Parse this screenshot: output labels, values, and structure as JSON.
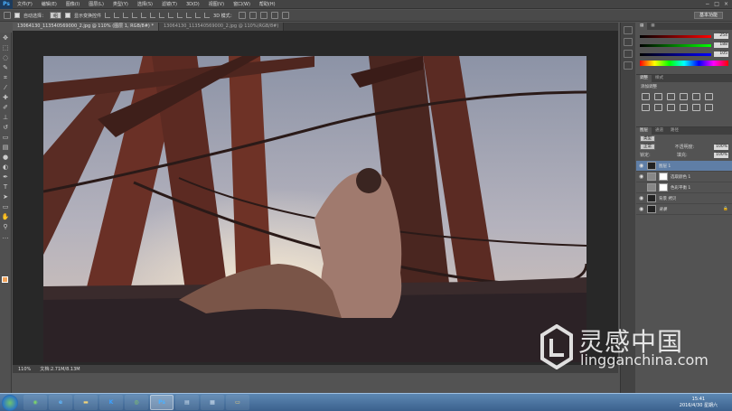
{
  "menubar": {
    "logo": "Ps",
    "items": [
      "文件(F)",
      "编辑(E)",
      "图像(I)",
      "图层(L)",
      "类型(Y)",
      "选择(S)",
      "滤镜(T)",
      "3D(D)",
      "视图(V)",
      "窗口(W)",
      "帮助(H)"
    ]
  },
  "options": {
    "auto_select_label": "自动选择：",
    "auto_select_value": "组",
    "show_transform_label": "显示变换控件",
    "mode_3d_label": "3D 模式：",
    "workspace_label": "基本功能"
  },
  "tabs": [
    {
      "label": "13064130_113540569000_2.jpg @ 110% (图层 1, RGB/8#) *",
      "active": true
    },
    {
      "label": "13064130_113540569000_2.jpg @ 110%(RGB/8#)",
      "active": false
    }
  ],
  "status": {
    "zoom": "110%",
    "doc": "文档:2.71M/8.13M"
  },
  "color_panel": {
    "values": [
      "254",
      "188",
      "105"
    ]
  },
  "adjustments": {
    "tabs": [
      "调整",
      "样式"
    ],
    "title": "添加调整"
  },
  "layers_panel": {
    "tabs": [
      "图层",
      "通道",
      "路径"
    ],
    "kind_label": "类型",
    "blend_mode": "正常",
    "opacity_label": "不透明度:",
    "opacity_value": "100%",
    "lock_label": "锁定:",
    "fill_label": "填充:",
    "fill_value": "100%",
    "layers": [
      {
        "name": "图层 1",
        "selected": true,
        "visible": true,
        "mask": false
      },
      {
        "name": "选取颜色 1",
        "selected": false,
        "visible": true,
        "mask": true
      },
      {
        "name": "色彩平衡 1",
        "selected": false,
        "visible": false,
        "mask": true
      },
      {
        "name": "背景 拷贝",
        "selected": false,
        "visible": true,
        "mask": false
      },
      {
        "name": "背景",
        "selected": false,
        "visible": true,
        "mask": false
      }
    ]
  },
  "taskbar": {
    "time": "15:41",
    "date": "2016/4/30 星期六"
  },
  "watermark": {
    "cn": "灵感中国",
    "en": "lingganchina.com"
  },
  "colors": {
    "accent": "#5f7ea6",
    "fg_swatch": "#f2a35a"
  }
}
